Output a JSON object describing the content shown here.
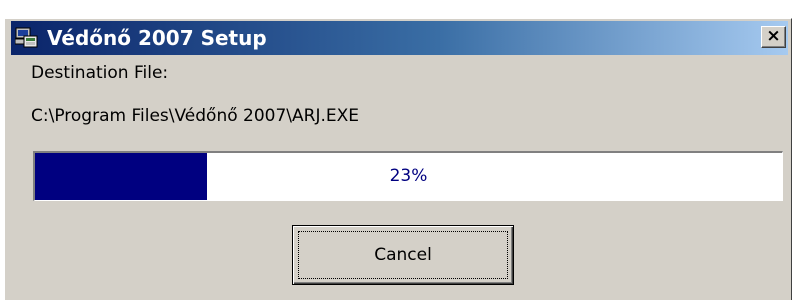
{
  "window": {
    "title": "Védőnő 2007 Setup",
    "icon": "installer-computer-icon",
    "close_label": "×"
  },
  "content": {
    "destination_label": "Destination File:",
    "destination_path": "C:\\Program Files\\Védőnő 2007\\ARJ.EXE"
  },
  "progress": {
    "value": 0.23,
    "label": "23%"
  },
  "buttons": {
    "cancel_label": "Cancel"
  },
  "colors": {
    "title_gradient_start": "#0a246a",
    "title_gradient_end": "#a6caf0",
    "progress_fill": "#000080",
    "dialog_face": "#d4d0c8"
  }
}
